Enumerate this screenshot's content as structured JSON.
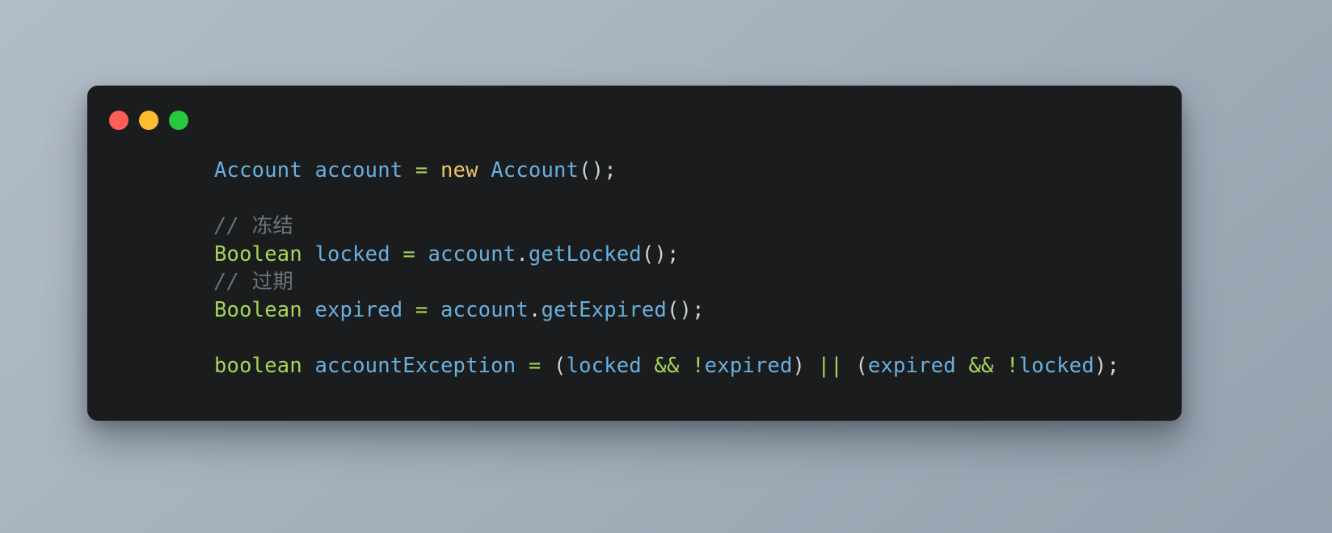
{
  "window": {
    "background_color": "#1b1c1d",
    "traffic_lights": [
      {
        "name": "close",
        "color": "#ff5f57"
      },
      {
        "name": "minimize",
        "color": "#febc2e"
      },
      {
        "name": "maximize",
        "color": "#28c840"
      }
    ]
  },
  "theme": {
    "page_background_from": "#b2bcc7",
    "page_background_to": "#95a1ae",
    "identifier_color": "#6ab0de",
    "keyword_color": "#e8c56b",
    "primitive_color": "#a6d65a",
    "operator_color": "#a6d65a",
    "punctuation_color": "#cfd4d6",
    "comment_color": "#6b7478"
  },
  "code": {
    "language": "java",
    "plain_text": "Account account = new Account();\n\n// 冻结\nBoolean locked = account.getLocked();\n// 过期\nBoolean expired = account.getExpired();\n\nboolean accountException = (locked && !expired) || (expired && !locked);",
    "lines": [
      {
        "index": 1,
        "text": "Account account = new Account();",
        "tokens": [
          {
            "t": "Account",
            "k": "type"
          },
          {
            "t": " ",
            "k": "plain"
          },
          {
            "t": "account",
            "k": "ident"
          },
          {
            "t": " ",
            "k": "plain"
          },
          {
            "t": "=",
            "k": "op"
          },
          {
            "t": " ",
            "k": "plain"
          },
          {
            "t": "new",
            "k": "kw"
          },
          {
            "t": " ",
            "k": "plain"
          },
          {
            "t": "Account",
            "k": "type"
          },
          {
            "t": "();",
            "k": "punc"
          }
        ]
      },
      {
        "index": 2,
        "text": "",
        "tokens": []
      },
      {
        "index": 3,
        "text": "// 冻结",
        "tokens": [
          {
            "t": "// ",
            "k": "comment"
          },
          {
            "t": "冻结",
            "k": "comment-cjk"
          }
        ]
      },
      {
        "index": 4,
        "text": "Boolean locked = account.getLocked();",
        "tokens": [
          {
            "t": "Boolean",
            "k": "prim"
          },
          {
            "t": " ",
            "k": "plain"
          },
          {
            "t": "locked",
            "k": "ident"
          },
          {
            "t": " ",
            "k": "plain"
          },
          {
            "t": "=",
            "k": "op"
          },
          {
            "t": " ",
            "k": "plain"
          },
          {
            "t": "account",
            "k": "ident"
          },
          {
            "t": ".",
            "k": "punc"
          },
          {
            "t": "getLocked",
            "k": "ident"
          },
          {
            "t": "();",
            "k": "punc"
          }
        ]
      },
      {
        "index": 5,
        "text": "// 过期",
        "tokens": [
          {
            "t": "// ",
            "k": "comment"
          },
          {
            "t": "过期",
            "k": "comment-cjk"
          }
        ]
      },
      {
        "index": 6,
        "text": "Boolean expired = account.getExpired();",
        "tokens": [
          {
            "t": "Boolean",
            "k": "prim"
          },
          {
            "t": " ",
            "k": "plain"
          },
          {
            "t": "expired",
            "k": "ident"
          },
          {
            "t": " ",
            "k": "plain"
          },
          {
            "t": "=",
            "k": "op"
          },
          {
            "t": " ",
            "k": "plain"
          },
          {
            "t": "account",
            "k": "ident"
          },
          {
            "t": ".",
            "k": "punc"
          },
          {
            "t": "getExpired",
            "k": "ident"
          },
          {
            "t": "();",
            "k": "punc"
          }
        ]
      },
      {
        "index": 7,
        "text": "",
        "tokens": []
      },
      {
        "index": 8,
        "text": "boolean accountException = (locked && !expired) || (expired && !locked);",
        "tokens": [
          {
            "t": "boolean",
            "k": "prim"
          },
          {
            "t": " ",
            "k": "plain"
          },
          {
            "t": "accountException",
            "k": "ident"
          },
          {
            "t": " ",
            "k": "plain"
          },
          {
            "t": "=",
            "k": "op"
          },
          {
            "t": " ",
            "k": "plain"
          },
          {
            "t": "(",
            "k": "punc"
          },
          {
            "t": "locked",
            "k": "ident"
          },
          {
            "t": " ",
            "k": "plain"
          },
          {
            "t": "&&",
            "k": "op"
          },
          {
            "t": " ",
            "k": "plain"
          },
          {
            "t": "!",
            "k": "op"
          },
          {
            "t": "expired",
            "k": "ident"
          },
          {
            "t": ")",
            "k": "punc"
          },
          {
            "t": " ",
            "k": "plain"
          },
          {
            "t": "||",
            "k": "op"
          },
          {
            "t": " ",
            "k": "plain"
          },
          {
            "t": "(",
            "k": "punc"
          },
          {
            "t": "expired",
            "k": "ident"
          },
          {
            "t": " ",
            "k": "plain"
          },
          {
            "t": "&&",
            "k": "op"
          },
          {
            "t": " ",
            "k": "plain"
          },
          {
            "t": "!",
            "k": "op"
          },
          {
            "t": "locked",
            "k": "ident"
          },
          {
            "t": ");",
            "k": "punc"
          }
        ]
      }
    ]
  }
}
